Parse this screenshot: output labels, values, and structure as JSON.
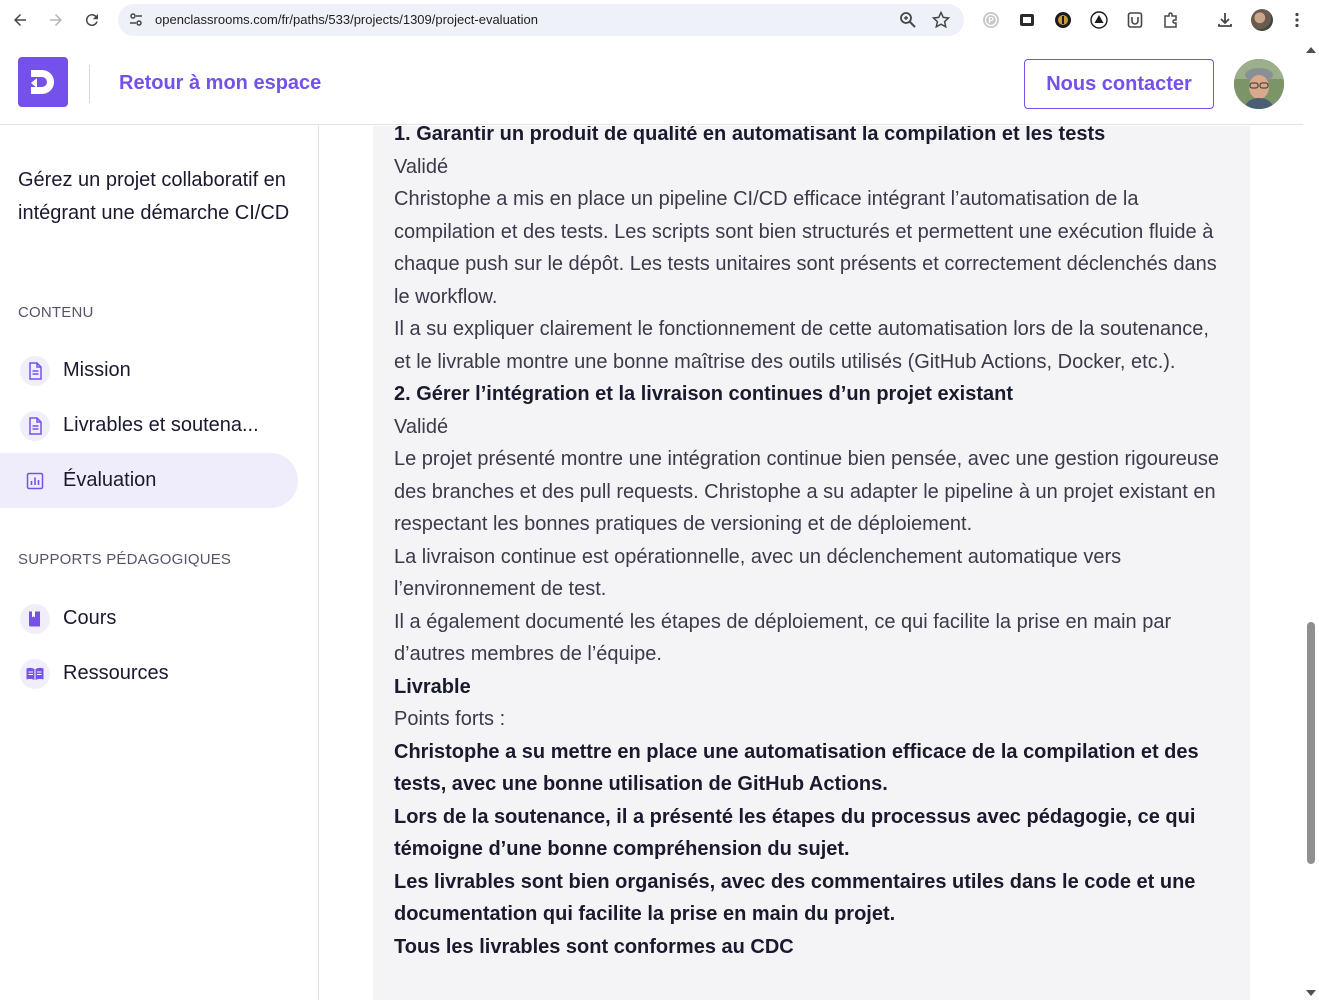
{
  "browser": {
    "url": "openclassrooms.com/fr/paths/533/projects/1309/project-evaluation"
  },
  "header": {
    "back_label": "Retour à mon espace",
    "contact_label": "Nous contacter"
  },
  "sidebar": {
    "project_title": "Gérez un projet collaboratif en intégrant une démarche CI/CD",
    "content_section_label": "CONTENU",
    "content_items": [
      {
        "label": "Mission",
        "icon": "document-icon"
      },
      {
        "label": "Livrables et soutena...",
        "icon": "document-icon"
      },
      {
        "label": "Évaluation",
        "icon": "chart-icon",
        "active": true
      }
    ],
    "supports_section_label": "SUPPORTS PÉDAGOGIQUES",
    "support_items": [
      {
        "label": "Cours",
        "icon": "book-icon"
      },
      {
        "label": "Ressources",
        "icon": "open-book-icon"
      }
    ]
  },
  "content": {
    "blocks": [
      {
        "style": "bold",
        "text": "1. Garantir un produit de qualité en automatisant la compilation et les tests"
      },
      {
        "style": "normal",
        "text": "Validé"
      },
      {
        "style": "normal",
        "text": "Christophe a mis en place un pipeline CI/CD efficace intégrant l’automatisation de la compilation et des tests. Les scripts sont bien structurés et permettent une exécution fluide à chaque push sur le dépôt. Les tests unitaires sont présents et correctement déclenchés dans le workflow."
      },
      {
        "style": "normal",
        "text": "Il a su expliquer clairement le fonctionnement de cette automatisation lors de la soutenance, et le livrable montre une bonne maîtrise des outils utilisés (GitHub Actions, Docker, etc.)."
      },
      {
        "style": "bold",
        "text": "2. Gérer l’intégration et la livraison continues d’un projet existant"
      },
      {
        "style": "normal",
        "text": "Validé"
      },
      {
        "style": "normal",
        "text": "Le projet présenté montre une intégration continue bien pensée, avec une gestion rigoureuse des branches et des pull requests. Christophe a su adapter le pipeline à un projet existant en respectant les bonnes pratiques de versioning et de déploiement."
      },
      {
        "style": "normal",
        "text": "La livraison continue est opérationnelle, avec un déclenchement automatique vers l’environnement de test."
      },
      {
        "style": "normal",
        "text": "Il a également documenté les étapes de déploiement, ce qui facilite la prise en main par d’autres membres de l’équipe."
      },
      {
        "style": "bold",
        "text": "Livrable"
      },
      {
        "style": "normal",
        "text": "Points forts :"
      },
      {
        "style": "bold",
        "text": "Christophe a su mettre en place une automatisation efficace de la compilation et des tests, avec une bonne utilisation de GitHub Actions."
      },
      {
        "style": "bold",
        "text": "Lors de la soutenance, il a présenté les étapes du processus avec pédagogie, ce qui témoigne d’une bonne compréhension du sujet."
      },
      {
        "style": "bold",
        "text": "Les livrables sont bien organisés, avec des commentaires utiles dans le code et une documentation qui facilite la prise en main du projet."
      },
      {
        "style": "bold",
        "text": "Tous les livrables sont conformes au CDC"
      }
    ]
  },
  "colors": {
    "brand": "#7451eb",
    "panel_bg": "#f4f4f6",
    "active_item_bg": "#efedfb"
  }
}
